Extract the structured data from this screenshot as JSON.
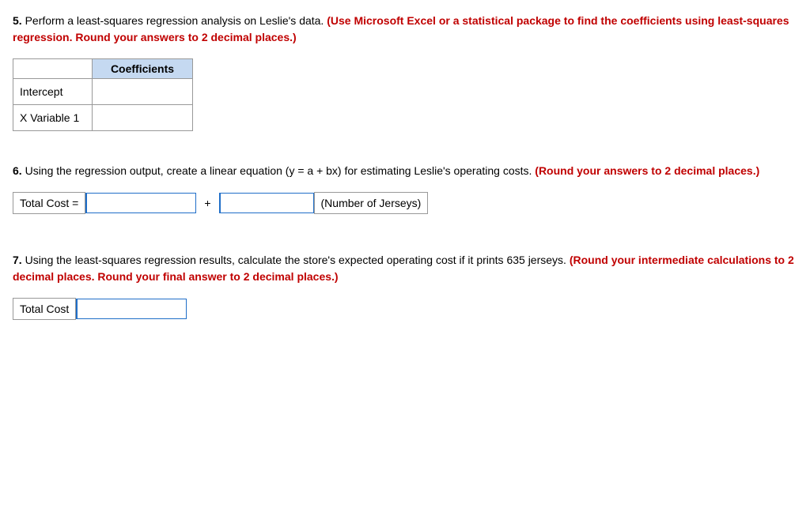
{
  "questions": {
    "q5": {
      "number": "5.",
      "text_plain": " Perform a least-squares regression analysis on Leslie's data. ",
      "text_highlight": "(Use Microsoft Excel or a statistical package to find the coefficients using least-squares regression. Round your answers to 2 decimal places.)",
      "table": {
        "header": "Coefficients",
        "rows": [
          {
            "label": "Intercept",
            "value": ""
          },
          {
            "label": "X Variable 1",
            "value": ""
          }
        ]
      }
    },
    "q6": {
      "number": "6.",
      "text_plain": " Using the regression output, create a linear equation (y = a + bx) for estimating Leslie's operating costs. ",
      "text_highlight": "(Round your answers to 2 decimal places.)",
      "equation": {
        "label": "Total Cost =",
        "plus": "+",
        "suffix": "(Number of Jerseys)",
        "input1_placeholder": "",
        "input2_placeholder": ""
      }
    },
    "q7": {
      "number": "7.",
      "text_plain": " Using the least-squares regression results, calculate the store's expected operating cost if it prints 635 jerseys. ",
      "text_highlight": "(Round your intermediate calculations to 2 decimal places. Round your final answer to 2 decimal places.)",
      "total_cost": {
        "label": "Total Cost",
        "input_placeholder": ""
      }
    }
  }
}
